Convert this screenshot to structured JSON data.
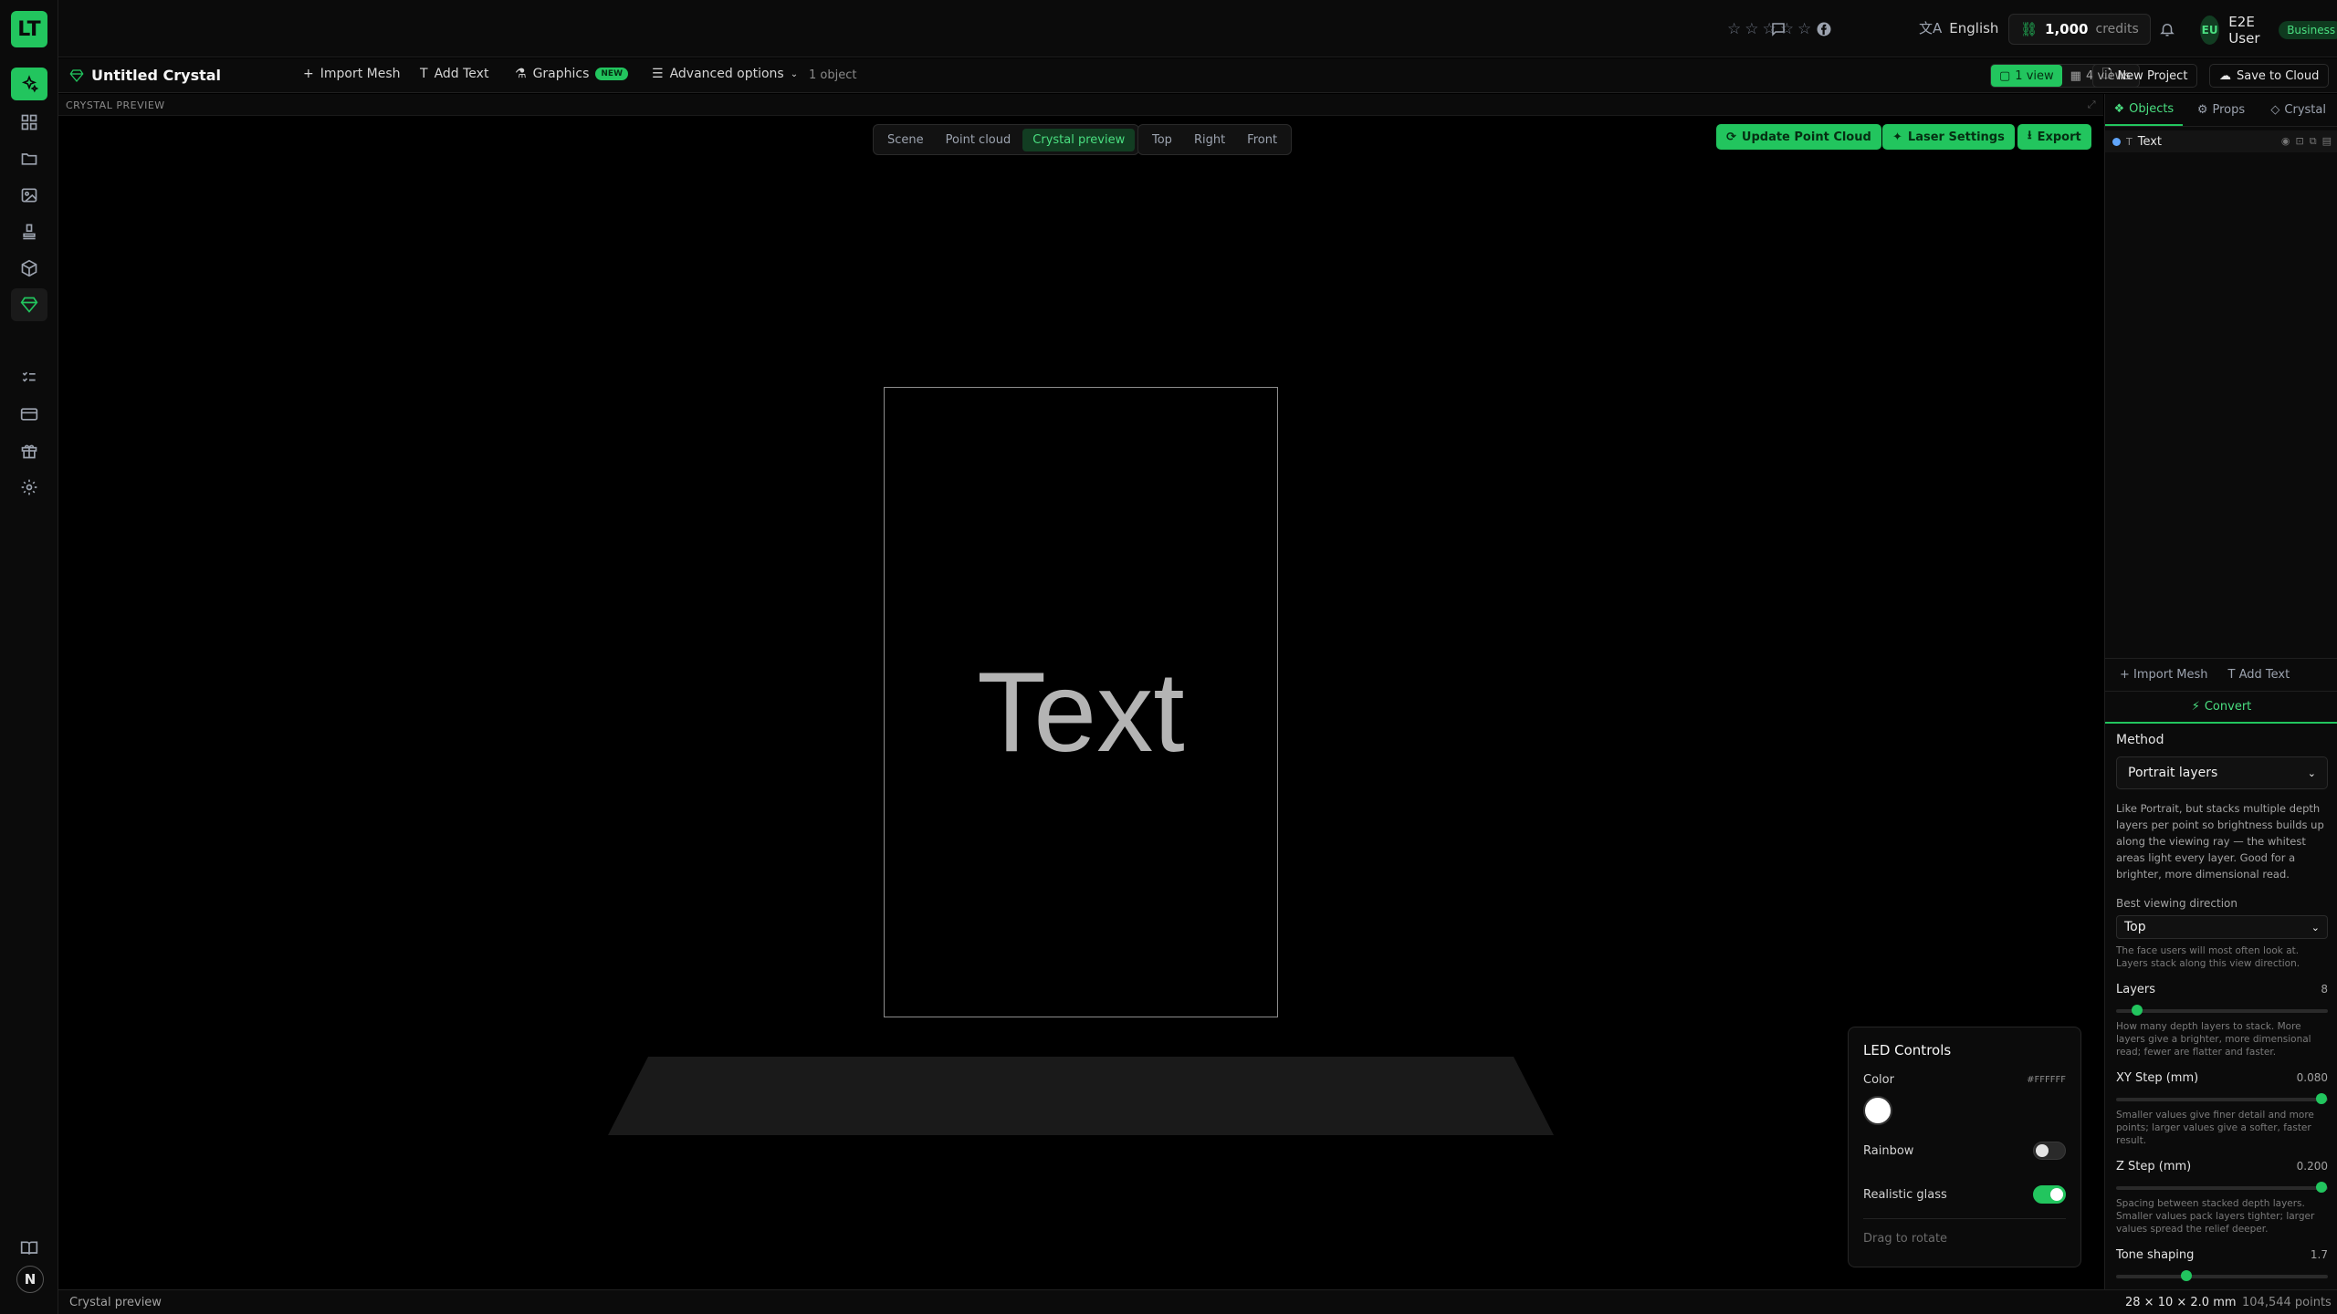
{
  "app": {
    "logo": "LT"
  },
  "topbar": {
    "stars": "☆☆☆☆☆",
    "language": "English",
    "credits_value": "1,000",
    "credits_label": "credits",
    "user_initials": "EU",
    "user_name": "E2E User",
    "plan_badge": "Business"
  },
  "toolbar": {
    "project_title": "Untitled Crystal",
    "import_mesh": "Import Mesh",
    "add_text": "Add Text",
    "graphics": "Graphics",
    "graphics_badge": "NEW",
    "advanced": "Advanced options",
    "object_count": "1 object",
    "view_1": "1 view",
    "view_4": "4 views",
    "new_project": "New Project",
    "save_cloud": "Save to Cloud"
  },
  "preview": {
    "header": "CRYSTAL PREVIEW",
    "modes": [
      "Scene",
      "Point cloud",
      "Crystal preview"
    ],
    "active_mode": "Crystal preview",
    "views": [
      "Top",
      "Right",
      "Front"
    ],
    "update_btn": "Update Point Cloud",
    "laser_btn": "Laser Settings",
    "export_btn": "Export",
    "crystal_text": "Text"
  },
  "led": {
    "title": "LED Controls",
    "color_label": "Color",
    "color_hex": "#FFFFFF",
    "rainbow_label": "Rainbow",
    "rainbow_on": false,
    "glass_label": "Realistic glass",
    "glass_on": true,
    "hint": "Drag to rotate"
  },
  "panel": {
    "tabs": [
      "Objects",
      "Props",
      "Crystal"
    ],
    "object_name": "Text",
    "import_mesh": "Import Mesh",
    "add_text": "Add Text",
    "convert": "Convert",
    "method_label": "Method",
    "method_value": "Portrait layers",
    "method_desc": "Like Portrait, but stacks multiple depth layers per point so brightness builds up along the viewing ray — the whitest areas light every layer. Good for a brighter, more dimensional read.",
    "view_dir_label": "Best viewing direction",
    "view_dir_value": "Top",
    "view_dir_desc": "The face users will most often look at. Layers stack along this view direction.",
    "layers_label": "Layers",
    "layers_value": "8",
    "layers_fill": 0.1,
    "layers_desc": "How many depth layers to stack. More layers give a brighter, more dimensional read; fewer are flatter and faster.",
    "xy_label": "XY Step (mm)",
    "xy_value": "0.080",
    "xy_fill": 0.97,
    "xy_desc": "Smaller values give finer detail and more points; larger values give a softer, faster result.",
    "z_label": "Z Step (mm)",
    "z_value": "0.200",
    "z_fill": 0.97,
    "z_desc": "Spacing between stacked depth layers. Smaller values pack layers tighter; larger values spread the relief deeper.",
    "tone_label": "Tone shaping",
    "tone_value": "1.7",
    "tone_fill": 0.33
  },
  "status": {
    "left": "Crystal preview",
    "dims": "28 × 10 × 2.0 mm",
    "points": "104,544 points"
  },
  "colors": {
    "accent": "#22c55e",
    "bg": "#000000",
    "panel": "#0b0b0b"
  }
}
